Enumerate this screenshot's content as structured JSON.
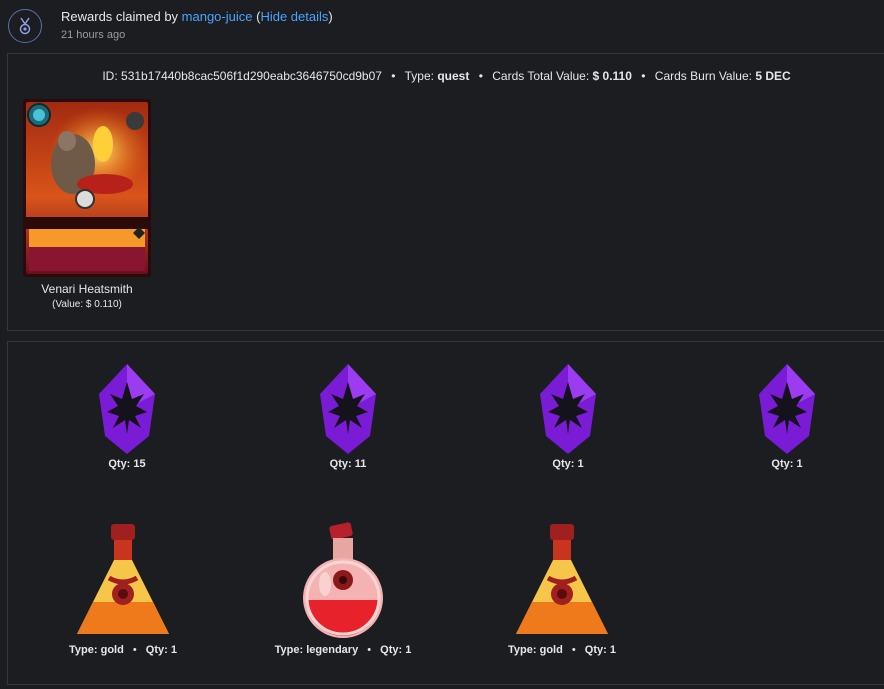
{
  "header": {
    "prefix": "Rewards claimed by ",
    "user": "mango-juice",
    "open_paren": "(",
    "hide_details": "Hide details",
    "close_paren": ")",
    "time": "21 hours ago",
    "avatar_icon": "medal-icon"
  },
  "summary": {
    "id_label": "ID:",
    "id_value": "531b17440b8cac506f1d290eabc3646750cd9b07",
    "type_label": "Type:",
    "type_value": "quest",
    "total_label": "Cards Total Value:",
    "total_value": "$ 0.110",
    "burn_label": "Cards Burn Value:",
    "burn_value": "5 DEC",
    "separator": "•"
  },
  "card": {
    "name": "Venari Heatsmith",
    "value_text": "(Value: $ 0.110)"
  },
  "shards": [
    {
      "qty_label": "Qty:",
      "qty": "15",
      "icon": "purple-shard-icon"
    },
    {
      "qty_label": "Qty:",
      "qty": "11",
      "icon": "purple-shard-icon"
    },
    {
      "qty_label": "Qty:",
      "qty": "1",
      "icon": "purple-shard-icon"
    },
    {
      "qty_label": "Qty:",
      "qty": "1",
      "icon": "purple-shard-icon"
    }
  ],
  "potions": [
    {
      "type_label": "Type:",
      "type": "gold",
      "qty_label": "Qty:",
      "qty": "1",
      "icon": "gold-potion-icon"
    },
    {
      "type_label": "Type:",
      "type": "legendary",
      "qty_label": "Qty:",
      "qty": "1",
      "icon": "legendary-potion-icon"
    },
    {
      "type_label": "Type:",
      "type": "gold",
      "qty_label": "Qty:",
      "qty": "1",
      "icon": "gold-potion-icon"
    }
  ],
  "colors": {
    "link": "#4aa3ff",
    "background": "#1b1d21",
    "shard": "#7a1bd6",
    "potion_red": "#d42a2a",
    "potion_gold": "#f2b632"
  }
}
